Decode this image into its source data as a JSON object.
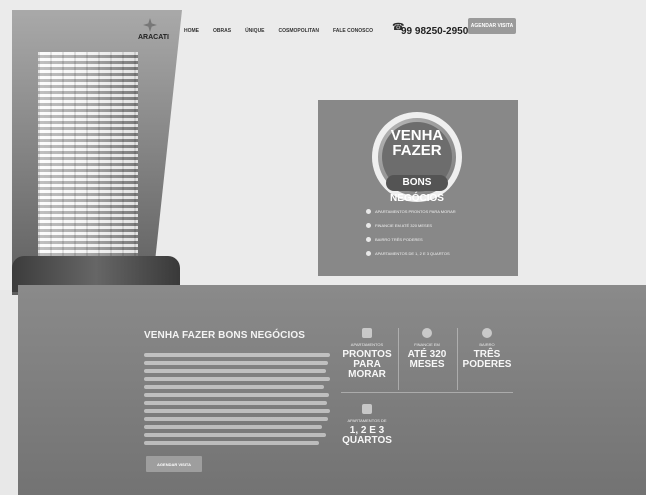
{
  "header": {
    "logo": "ARACATI",
    "logo_subtitle": "",
    "nav": [
      "HOME",
      "OBRAS",
      "ÚNIQUE",
      "COSMOPOLITAN",
      "FALE CONOSCO"
    ],
    "phone_label": "",
    "phone": "99 98250-2950",
    "top_button": "AGENDAR VISITA"
  },
  "promo": {
    "badge_title": "VENHA FAZER",
    "badge_strip": "BONS NEGÓCIOS",
    "items": [
      "APARTAMENTOS PRONTOS PARA MORAR",
      "FINANCIE EM ATÉ 320 MESES",
      "BAIRRO TRÊS PODERES",
      "APARTAMENTOS DE 1, 2 E 3 QUARTOS"
    ]
  },
  "content": {
    "section_title": "VENHA FAZER BONS NEGÓCIOS",
    "bottom_button": "AGENDAR VISITA",
    "features": [
      {
        "label": "APARTAMENTOS",
        "value": "PRONTOS\nPARA\nMORAR"
      },
      {
        "label": "FINANCIE EM",
        "value": "ATÉ 320\nMESES"
      },
      {
        "label": "BAIRRO",
        "value": "TRÊS\nPODERES"
      },
      {
        "label": "APARTAMENTOS DE",
        "value": "1, 2 E 3\nQUARTOS"
      }
    ]
  }
}
